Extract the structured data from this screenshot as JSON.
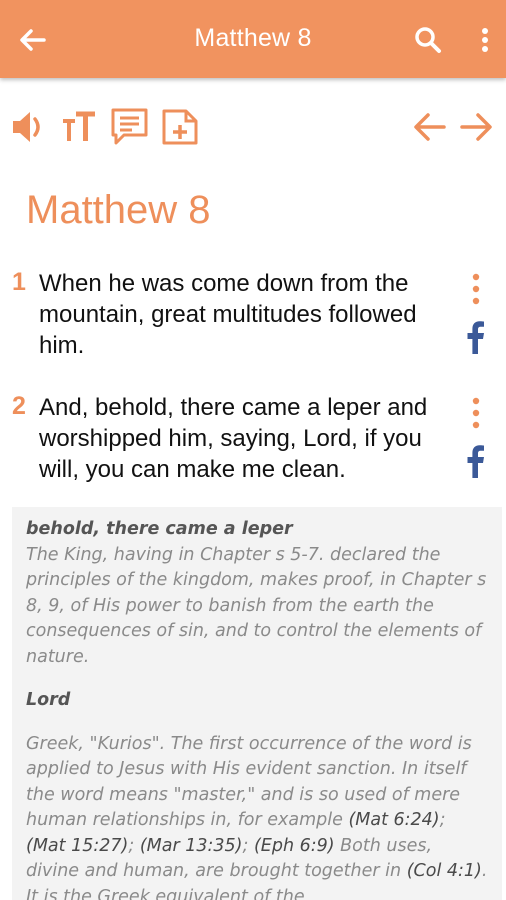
{
  "appbar": {
    "title": "Matthew 8",
    "icons": [
      "back-arrow-icon",
      "search-icon",
      "more-vert-icon"
    ]
  },
  "toolbar": {
    "icons": [
      "volume-icon",
      "text-size-icon",
      "comment-icon",
      "add-note-icon",
      "previous-arrow-icon",
      "next-arrow-icon"
    ]
  },
  "chapter": {
    "title": "Matthew 8"
  },
  "verses": [
    {
      "number": "1",
      "text": "When he was come down from the mountain, great multitudes followed him."
    },
    {
      "number": "2",
      "text": "And, behold, there came a leper and worshipped him, saying, Lord, if you will, you can make me clean."
    }
  ],
  "notes": {
    "note1": {
      "heading": "behold, there came a leper",
      "body": "The King, having in Chapter s 5-7. declared the principles of the kingdom, makes proof, in Chapter s 8, 9, of His power to banish from the earth the consequences of sin, and to control the elements of nature."
    },
    "note2": {
      "heading": "Lord",
      "body_part1": "Greek, \"Kurios\". The first occurrence of the word is applied to Jesus with His evident sanction. In itself the word means \"master,\" and is so used of mere human relationships in, for example ",
      "ref1": "(Mat 6:24)",
      "sep1": "; ",
      "ref2": "(Mat 15:27)",
      "sep2": "; ",
      "ref3": "(Mar 13:35)",
      "sep3": "; ",
      "ref4": "(Eph 6:9)",
      "body_part2": " Both uses, divine and human, are brought together in ",
      "ref5": "(Col 4:1)",
      "body_part3": ". It is the Greek equivalent of the"
    }
  },
  "colors": {
    "accent": "#f1935f",
    "accent_text": "#ee8f5b",
    "facebook": "#3b5998",
    "notes_bg": "#f3f3f3"
  }
}
